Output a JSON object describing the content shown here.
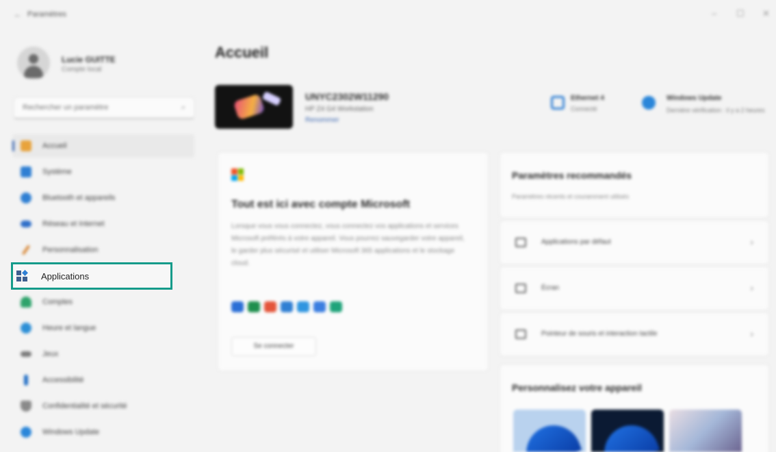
{
  "window": {
    "title": "Paramètres",
    "back_glyph": "←",
    "min_glyph": "–",
    "max_glyph": "☐",
    "close_glyph": "✕"
  },
  "user": {
    "name": "Lucie GUITTE",
    "account_type": "Compte local"
  },
  "search": {
    "placeholder": "Rechercher un paramètre",
    "icon_glyph": "⌕"
  },
  "sidebar": {
    "items": [
      {
        "label": "Accueil",
        "icon": "home-icon",
        "color": "#e8a33c"
      },
      {
        "label": "Système",
        "icon": "system-icon",
        "color": "#2f7fd3"
      },
      {
        "label": "Bluetooth et appareils",
        "icon": "bluetooth-icon",
        "color": "#2f7fd3"
      },
      {
        "label": "Réseau et Internet",
        "icon": "network-icon",
        "color": "#2f6fc8"
      },
      {
        "label": "Personnalisation",
        "icon": "brush-icon",
        "color": "#d8893a"
      },
      {
        "label": "Applications",
        "icon": "apps-icon",
        "color": "#3e5f8f"
      },
      {
        "label": "Comptes",
        "icon": "accounts-icon",
        "color": "#2ea36b"
      },
      {
        "label": "Heure et langue",
        "icon": "time-language-icon",
        "color": "#2d8fd6"
      },
      {
        "label": "Jeux",
        "icon": "games-icon",
        "color": "#7b7b7b"
      },
      {
        "label": "Accessibilité",
        "icon": "accessibility-icon",
        "color": "#2470c6"
      },
      {
        "label": "Confidentialité et sécurité",
        "icon": "shield-icon",
        "color": "#8a8a8a"
      },
      {
        "label": "Windows Update",
        "icon": "update-icon",
        "color": "#2a86d9"
      }
    ],
    "active_index": 0,
    "highlighted_index": 5
  },
  "main": {
    "title": "Accueil",
    "device": {
      "name": "UNYC2302W11290",
      "model": "HP Z4 G4 Workstation",
      "rename_link": "Renommer"
    },
    "status": [
      {
        "title": "Ethernet 4",
        "sub": "Connecté",
        "icon": "ethernet-icon",
        "color": "#2f7fd3"
      },
      {
        "title": "Windows Update",
        "sub": "Dernière vérification : il y a 2 heures",
        "icon": "update-icon",
        "color": "#2a86d9"
      }
    ],
    "ms_card": {
      "title": "Tout est ici avec compte Microsoft",
      "body": "Lorsque vous vous connectez, vous connectez vos applications et services Microsoft préférés à votre appareil. Vous pourrez sauvegarder votre appareil, le garder plus sécurisé et utiliser Microsoft 365 applications et le stockage cloud.",
      "button": "Se connecter",
      "app_icon_colors": [
        "#2b6fd6",
        "#1f8f4e",
        "#e4553a",
        "#2f7fd3",
        "#2f95e0",
        "#3a7ee0",
        "#1fa37a"
      ]
    },
    "recommended": {
      "title": "Paramètres recommandés",
      "subtitle": "Paramètres récents et couramment utilisés",
      "items": [
        {
          "label": "Applications par défaut",
          "icon": "default-apps-icon"
        },
        {
          "label": "Écran",
          "icon": "display-icon"
        },
        {
          "label": "Pointeur de souris et interaction tactile",
          "icon": "mouse-icon"
        }
      ],
      "chevron": "›"
    },
    "personalize": {
      "title": "Personnalisez votre appareil"
    }
  },
  "colors": {
    "highlight": "#159b8a",
    "accent": "#3d68b0"
  }
}
